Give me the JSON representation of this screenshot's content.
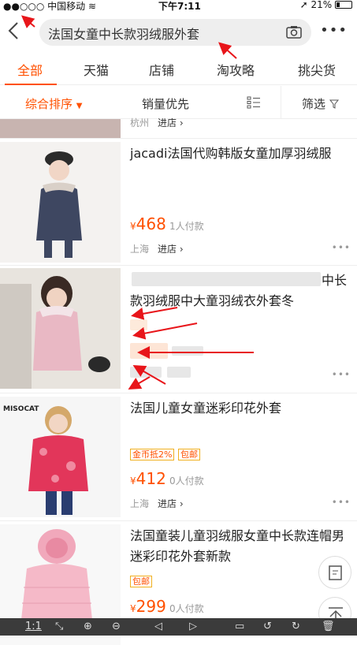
{
  "status": {
    "carrier": "中国移动",
    "time": "下午7:11",
    "battery": "21%"
  },
  "search": {
    "query": "法国女童中长款羽绒服外套"
  },
  "tabs": [
    {
      "label": "全部"
    },
    {
      "label": "天猫"
    },
    {
      "label": "店铺"
    },
    {
      "label": "淘攻略"
    },
    {
      "label": "挑尖货"
    }
  ],
  "sort": {
    "comprehensive": "综合排序",
    "sales": "销量优先",
    "filter": "筛选"
  },
  "items": [
    {
      "partial_loc": "杭州",
      "partial_shop": "进店"
    },
    {
      "title": "jacadi法国代购韩版女童加厚羽绒服",
      "price": "468",
      "paid": "1人付款",
      "location": "上海",
      "shop": "进店"
    },
    {
      "title_end": "中长",
      "title_line2": "款羽绒服中大童羽绒衣外套冬"
    },
    {
      "title": "法国儿童女童迷彩印花外套",
      "tags": [
        "金币抵2%",
        "包邮"
      ],
      "price": "412",
      "paid": "0人付款",
      "location": "上海",
      "shop": "进店",
      "brand": "MISOCAT"
    },
    {
      "title": "法国童装儿童羽绒服女童中长款连帽男迷彩印花外套新款",
      "tags": [
        "包邮"
      ],
      "price": "299",
      "paid": "0人付款"
    }
  ],
  "bottombar": {
    "zoom": "1:1"
  },
  "colors": {
    "accent": "#ff5000",
    "annotation": "#e8151a"
  }
}
